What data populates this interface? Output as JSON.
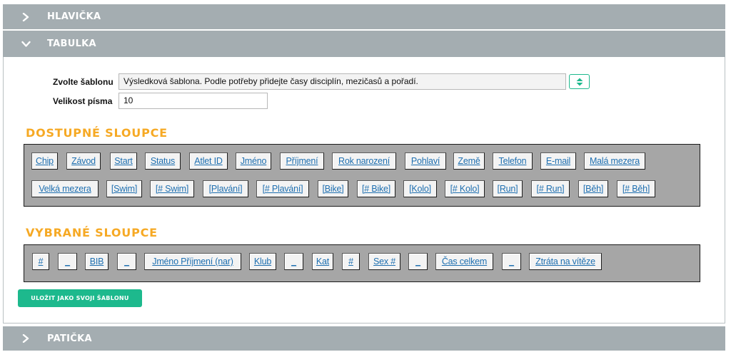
{
  "sections": {
    "header": {
      "label": "HLAVIČKA",
      "state": "collapsed"
    },
    "table": {
      "label": "TABULKA",
      "state": "expanded"
    },
    "footer": {
      "label": "PATIČKA",
      "state": "collapsed"
    }
  },
  "form": {
    "template_label": "Zvolte šablonu",
    "template_value": "Výsledková šablona. Podle potřeby přidejte časy disciplín, mezičasů a pořadí.",
    "font_size_label": "Velikost písma",
    "font_size_value": "10"
  },
  "available": {
    "title": "DOSTUPNÉ SLOUPCE",
    "row1": [
      "Chip",
      "Závod",
      "Start",
      "Status",
      "Atlet ID",
      "Jméno",
      "Příjmení",
      "Rok narození",
      "Pohlaví",
      "Země",
      "Telefon",
      "E-mail",
      "Malá mezera"
    ],
    "row2": [
      "Velká mezera",
      "[Swim]",
      "[# Swim]",
      "[Plavání]",
      "[# Plavání]",
      "[Bike]",
      "[# Bike]",
      "[Kolo]",
      "[# Kolo]",
      "[Run]",
      "[# Run]",
      "[Běh]",
      "[# Běh]"
    ]
  },
  "selected": {
    "title": "VYBRANÉ SLOUPCE",
    "items": [
      "#",
      "_",
      "BIB",
      "_",
      "Jméno Příjmení (nar)",
      "Klub",
      "_",
      "Kat",
      "#",
      "Sex #",
      "_",
      "Čas celkem",
      "_",
      "Ztráta na vítěze"
    ]
  },
  "save_button": "ULOŽIT JAKO SVOJI ŠABLONU",
  "icons": {
    "collapsed": "chevron-right-icon",
    "expanded": "chevron-down-icon",
    "stepper": "up-down-arrows-icon"
  },
  "colors": {
    "section_bar": "#a4adb1",
    "group_title": "#f6a924",
    "accent": "#1db98d",
    "chip_link": "#1e6fb0",
    "column_box": "#a6a6a6"
  }
}
